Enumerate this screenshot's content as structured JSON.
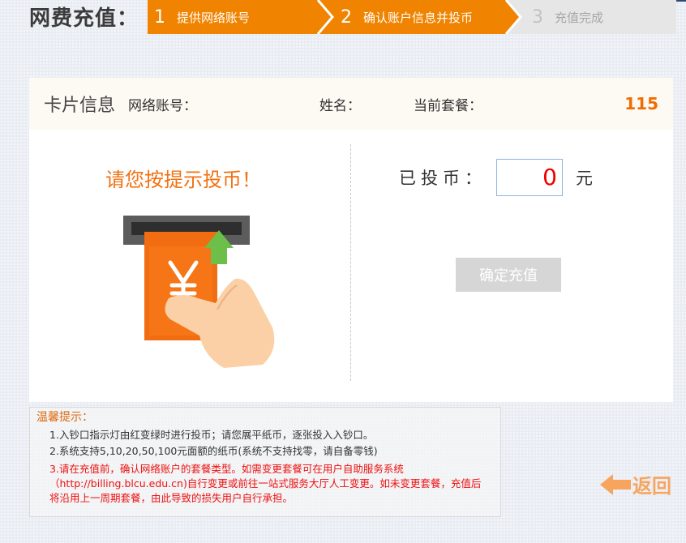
{
  "header": {
    "title": "网费充值：",
    "steps": [
      {
        "num": "1",
        "label": "提供网络账号",
        "state": "done"
      },
      {
        "num": "2",
        "label": "确认账户信息并投币",
        "state": "active"
      },
      {
        "num": "3",
        "label": "充值完成",
        "state": "pending"
      }
    ]
  },
  "card_info": {
    "title": "卡片信息",
    "account_label": "网络账号：",
    "name_label": "姓名：",
    "package_label": "当前套餐：",
    "package_value": "115"
  },
  "coin_panel": {
    "prompt": "请您按提示投币！",
    "inserted_label": "已投币：",
    "inserted_value": "0",
    "unit": "元",
    "confirm_label": "确定充值",
    "illustration_icon": "insert-banknote-icon"
  },
  "tips": {
    "title": "温馨提示：",
    "items": [
      "1.入钞口指示灯由红变绿时进行投币；请您展平纸币，逐张投入入钞口。",
      "2.系统支持5,10,20,50,100元面额的纸币(系统不支持找零，请自备零钱)",
      "3.请在充值前，确认网络账户的套餐类型。如需变更套餐可在用户自助服务系统（http://billing.blcu.edu.cn)自行变更或前往一站式服务大厅人工变更。如未变更套餐，充值后将沿用上一周期套餐，由此导致的损失用户自行承担。"
    ]
  },
  "nav": {
    "return_label": "返回"
  },
  "colors": {
    "accent": "#f08300",
    "warning": "#ee1111",
    "value_red": "#ee0000"
  }
}
